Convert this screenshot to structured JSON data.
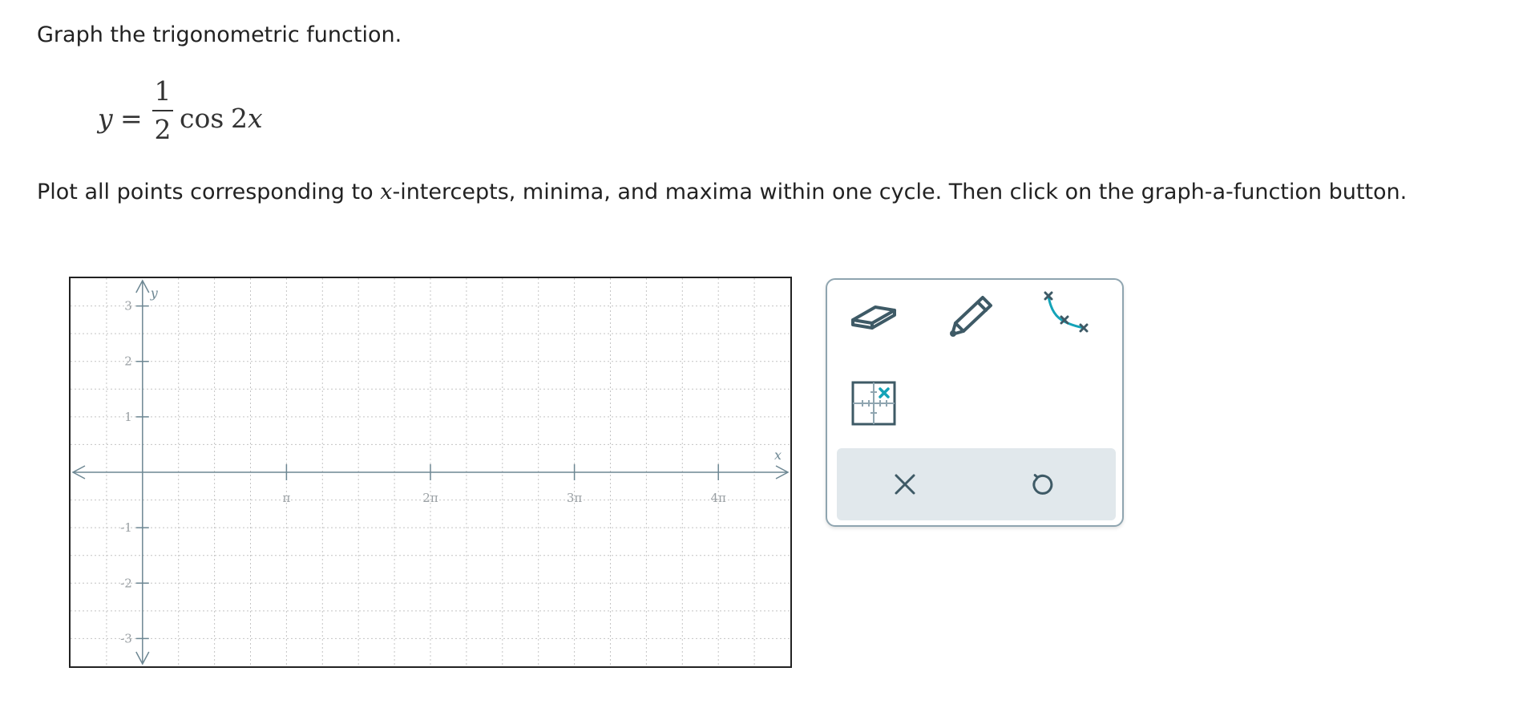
{
  "prompt": "Graph the trigonometric function.",
  "equation": {
    "lhs": "y",
    "equals": "=",
    "numerator": "1",
    "denominator": "2",
    "func": "cos",
    "arg_coef": "2",
    "arg_var": "x"
  },
  "instructions": {
    "before": "Plot all points corresponding to ",
    "var": "x",
    "after": "-intercepts, minima, and maxima within one cycle. Then click on the graph-a-function button."
  },
  "graph": {
    "x_axis_label": "x",
    "y_axis_label": "y",
    "x_range_pi_units": [
      -0.5,
      4.5
    ],
    "y_range": [
      -3.5,
      3.5
    ],
    "x_tick_labels": [
      "π",
      "2π",
      "3π",
      "4π"
    ],
    "y_tick_labels": [
      "3",
      "2",
      "1",
      "-1",
      "-2",
      "-3"
    ],
    "minor_grid_per_unit": 4,
    "grid": "dotted",
    "colors": {
      "axis": "#6d8793",
      "grid": "#c4c4c4",
      "tick_label": "#9aa0a4"
    }
  },
  "tools": {
    "eraser": "eraser-icon",
    "pencil": "pencil-icon",
    "graph_function": "graph-function-icon",
    "point": "point-plot-icon",
    "clear": "close-icon",
    "undo": "undo-icon",
    "colors": {
      "icon": "#3e5a66",
      "accent": "#14a3b8",
      "panel_border": "#8fa5b0",
      "action_bar": "#e1e8ec"
    }
  }
}
